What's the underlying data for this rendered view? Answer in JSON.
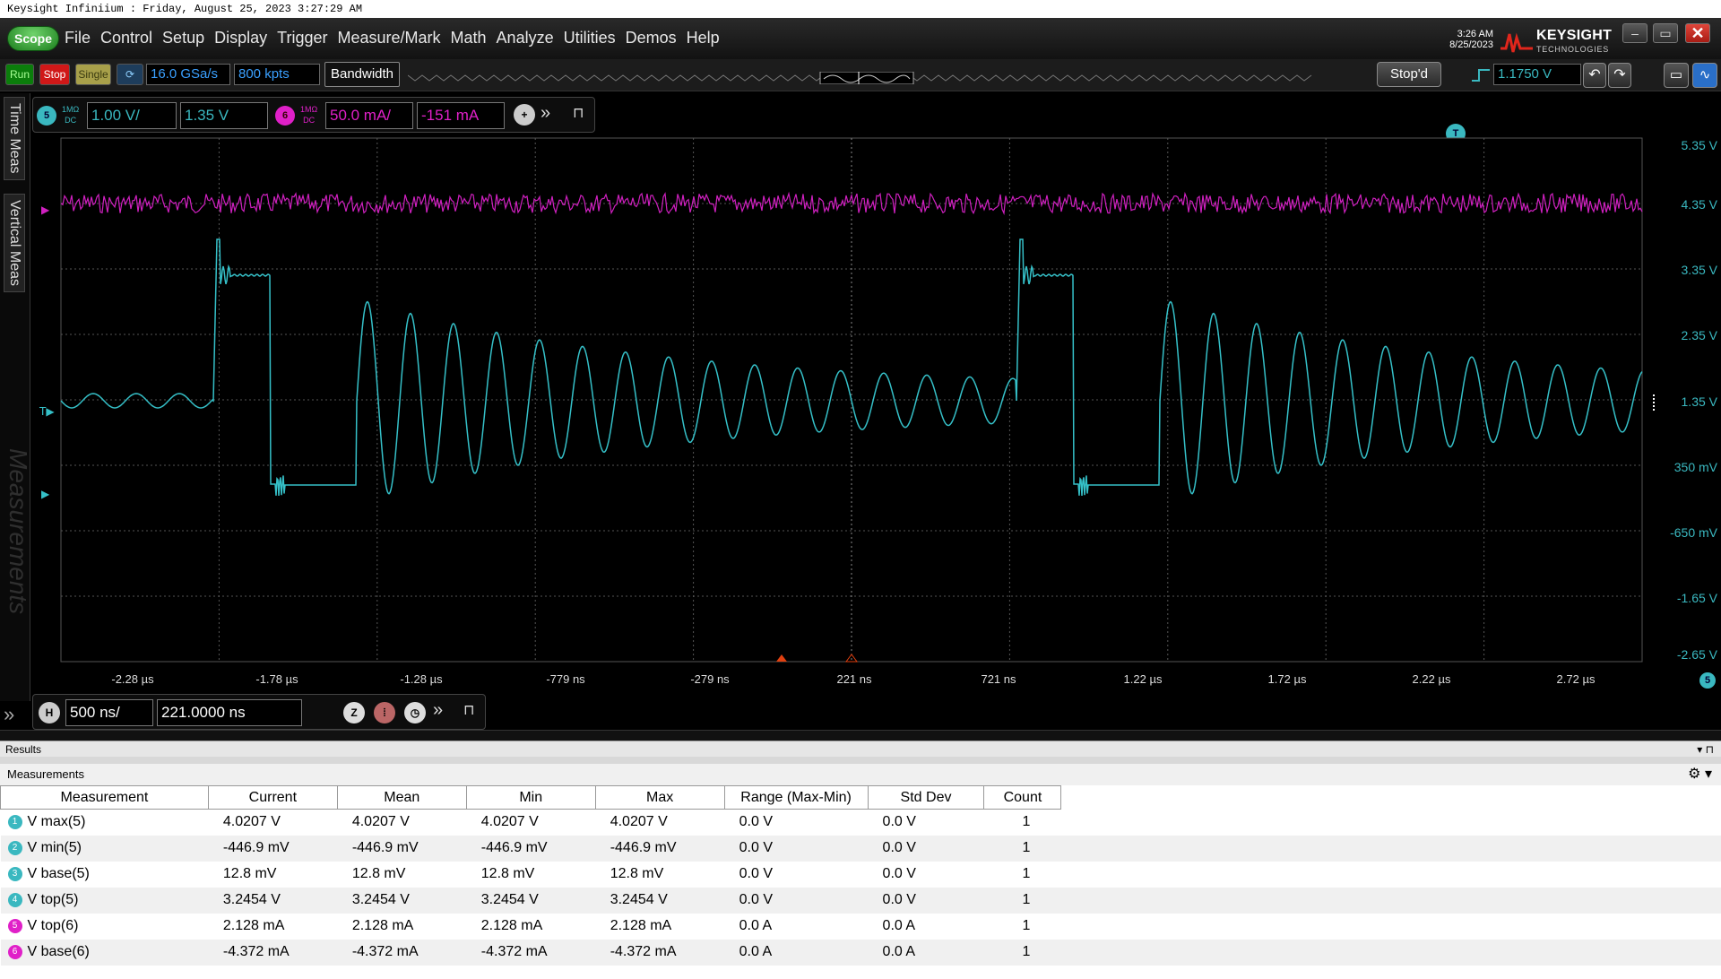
{
  "caption": "Keysight Infiniium : Friday, August 25, 2023 3:27:29 AM",
  "scope_logo": "Scope",
  "menu": [
    "File",
    "Control",
    "Setup",
    "Display",
    "Trigger",
    "Measure/Mark",
    "Math",
    "Analyze",
    "Utilities",
    "Demos",
    "Help"
  ],
  "clock": {
    "time": "3:26 AM",
    "date": "8/25/2023"
  },
  "brand": {
    "name": "KEYSIGHT",
    "sub": "TECHNOLOGIES"
  },
  "toolbar": {
    "run": "Run",
    "stop": "Stop",
    "single": "Single",
    "sample_rate": "16.0 GSa/s",
    "memory_depth": "800 kpts",
    "bandwidth": "Bandwidth",
    "status": "Stop'd",
    "trigger_level": "1.1750 V"
  },
  "channels": [
    {
      "num": "5",
      "coupling_top": "1MΩ",
      "coupling_bot": "DC",
      "scale": "1.00 V/",
      "offset": "1.35 V",
      "color": "#3ab8c0"
    },
    {
      "num": "6",
      "coupling_top": "1MΩ",
      "coupling_bot": "DC",
      "scale": "50.0 mA/",
      "offset": "-151 mA",
      "color": "#e020c8"
    }
  ],
  "side_tabs": [
    "Time Meas",
    "Vertical Meas",
    "Measurements"
  ],
  "vertical_labels": [
    "5.35 V",
    "4.35 V",
    "3.35 V",
    "2.35 V",
    "1.35 V",
    "350 mV",
    "-650 mV",
    "-1.65 V",
    "-2.65 V"
  ],
  "time_labels": [
    "-2.28 µs",
    "-1.78 µs",
    "-1.28 µs",
    "-779 ns",
    "-279 ns",
    "221 ns",
    "721 ns",
    "1.22 µs",
    "1.72 µs",
    "2.22 µs",
    "2.72 µs"
  ],
  "horizontal": {
    "badge": "H",
    "scale": "500 ns/",
    "position": "221.0000 ns"
  },
  "results_title": "Results",
  "measurements_title": "Measurements",
  "table": {
    "headers": [
      "Measurement",
      "Current",
      "Mean",
      "Min",
      "Max",
      "Range (Max-Min)",
      "Std Dev",
      "Count"
    ],
    "rows": [
      {
        "badge": "1",
        "color": "#3ab8c0",
        "cells": [
          "V max(5)",
          "4.0207 V",
          "4.0207 V",
          "4.0207 V",
          "4.0207 V",
          "0.0 V",
          "0.0 V",
          "1"
        ]
      },
      {
        "badge": "2",
        "color": "#3ab8c0",
        "cells": [
          "V min(5)",
          "-446.9 mV",
          "-446.9 mV",
          "-446.9 mV",
          "-446.9 mV",
          "0.0 V",
          "0.0 V",
          "1"
        ]
      },
      {
        "badge": "3",
        "color": "#3ab8c0",
        "cells": [
          "V base(5)",
          "12.8 mV",
          "12.8 mV",
          "12.8 mV",
          "12.8 mV",
          "0.0 V",
          "0.0 V",
          "1"
        ]
      },
      {
        "badge": "4",
        "color": "#3ab8c0",
        "cells": [
          "V top(5)",
          "3.2454 V",
          "3.2454 V",
          "3.2454 V",
          "3.2454 V",
          "0.0 V",
          "0.0 V",
          "1"
        ]
      },
      {
        "badge": "5",
        "color": "#e020c8",
        "cells": [
          "V top(6)",
          "2.128 mA",
          "2.128 mA",
          "2.128 mA",
          "2.128 mA",
          "0.0 A",
          "0.0 A",
          "1"
        ]
      },
      {
        "badge": "6",
        "color": "#e020c8",
        "cells": [
          "V base(6)",
          "-4.372 mA",
          "-4.372 mA",
          "-4.372 mA",
          "-4.372 mA",
          "0.0 A",
          "0.0 A",
          "1"
        ]
      }
    ]
  }
}
